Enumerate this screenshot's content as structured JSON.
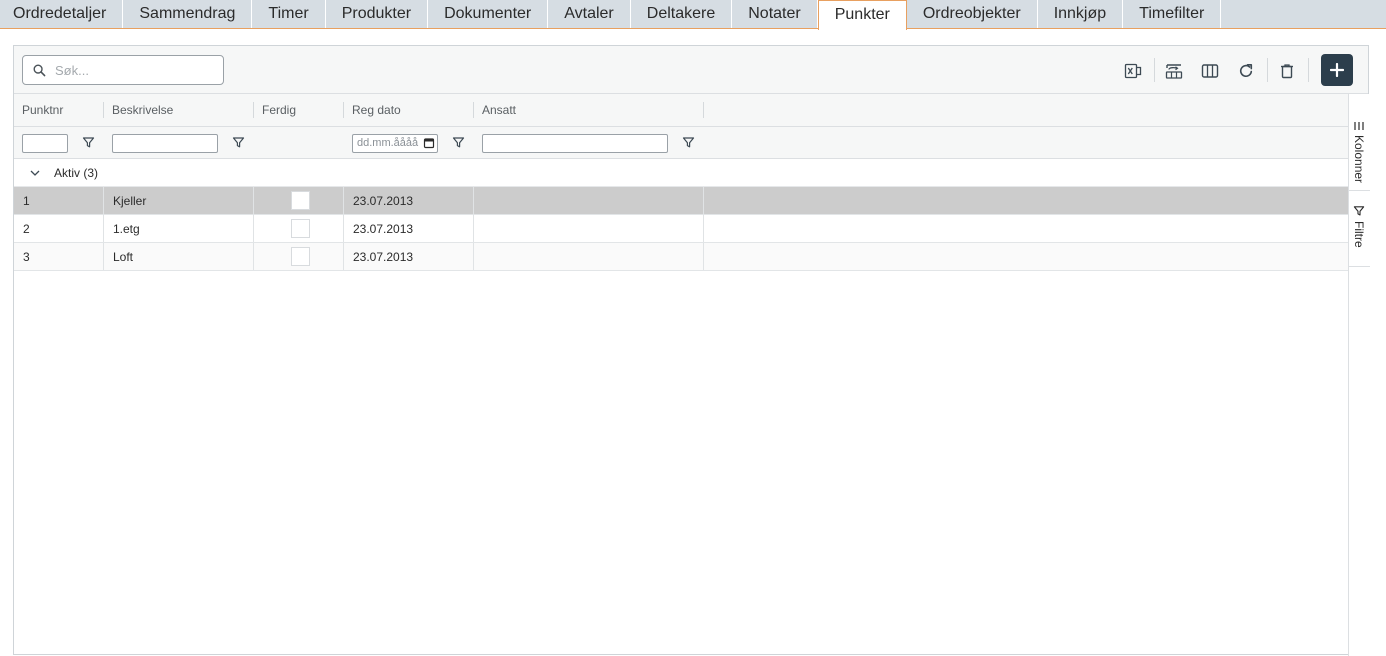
{
  "tabs": [
    {
      "label": "Ordredetaljer",
      "active": false
    },
    {
      "label": "Sammendrag",
      "active": false
    },
    {
      "label": "Timer",
      "active": false
    },
    {
      "label": "Produkter",
      "active": false
    },
    {
      "label": "Dokumenter",
      "active": false
    },
    {
      "label": "Avtaler",
      "active": false
    },
    {
      "label": "Deltakere",
      "active": false
    },
    {
      "label": "Notater",
      "active": false
    },
    {
      "label": "Punkter",
      "active": true
    },
    {
      "label": "Ordreobjekter",
      "active": false
    },
    {
      "label": "Innkjøp",
      "active": false
    },
    {
      "label": "Timefilter",
      "active": false
    }
  ],
  "toolbar": {
    "search_placeholder": "Søk...",
    "icons": [
      "excel-export-icon",
      "group-rows-icon",
      "columns-icon",
      "refresh-icon",
      "delete-icon"
    ],
    "add_label": "+"
  },
  "grid": {
    "columns": [
      "Punktnr",
      "Beskrivelse",
      "Ferdig",
      "Reg dato",
      "Ansatt"
    ],
    "date_filter_placeholder": "dd.mm.åååå",
    "group_label": "Aktiv (3)",
    "rows": [
      {
        "punktnr": "1",
        "beskrivelse": "Kjeller",
        "ferdig": false,
        "reg_dato": "23.07.2013",
        "ansatt": ""
      },
      {
        "punktnr": "2",
        "beskrivelse": "1.etg",
        "ferdig": false,
        "reg_dato": "23.07.2013",
        "ansatt": ""
      },
      {
        "punktnr": "3",
        "beskrivelse": "Loft",
        "ferdig": false,
        "reg_dato": "23.07.2013",
        "ansatt": ""
      }
    ]
  },
  "side_panel": {
    "columns_label": "Kolonner",
    "filters_label": "Filtre"
  },
  "colors": {
    "tab_bg": "#d6dde3",
    "tab_accent": "#e8a060",
    "add_button": "#2c3e4c",
    "selected_row": "#cccccc"
  }
}
